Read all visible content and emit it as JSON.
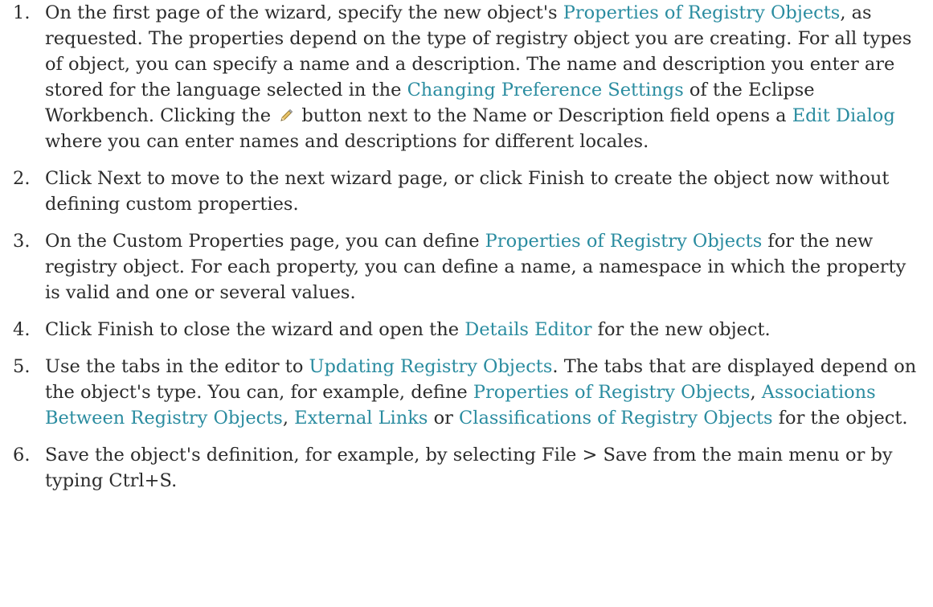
{
  "steps": [
    {
      "number": "1.",
      "segments": [
        {
          "text": "On the first page of the wizard, specify the new object's "
        },
        {
          "link": "Properties of Registry Objects"
        },
        {
          "text": ", as requested. The properties depend on the type of registry object you are creating. For all types of object, you can specify a name and a description. The name and description you enter are stored for the language selected in the "
        },
        {
          "link": "Changing Preference Settings"
        },
        {
          "text": " of the Eclipse Workbench. Clicking the "
        },
        {
          "icon": "pencil-icon"
        },
        {
          "text": " button next to the Name or Description field opens a "
        },
        {
          "link": "Edit Dialog"
        },
        {
          "text": " where you can enter names and descriptions for different locales."
        }
      ]
    },
    {
      "number": "2.",
      "segments": [
        {
          "text": "Click Next to move to the next wizard page, or click Finish to create the object now without defining custom properties."
        }
      ]
    },
    {
      "number": "3.",
      "segments": [
        {
          "text": "On the Custom Properties page, you can define "
        },
        {
          "link": "Properties of Registry Objects"
        },
        {
          "text": " for the new registry object. For each property, you can define a name, a namespace in which the property is valid and one or several values."
        }
      ]
    },
    {
      "number": "4.",
      "segments": [
        {
          "text": "Click Finish to close the wizard and open the "
        },
        {
          "link": "Details Editor"
        },
        {
          "text": " for the new object."
        }
      ]
    },
    {
      "number": "5.",
      "segments": [
        {
          "text": "Use the tabs in the editor to "
        },
        {
          "link": "Updating Registry Objects"
        },
        {
          "text": ". The tabs that are displayed depend on the object's type. You can, for example, define "
        },
        {
          "link": "Properties of Registry Objects"
        },
        {
          "text": ", "
        },
        {
          "link": "Associations Between Registry Objects"
        },
        {
          "text": ", "
        },
        {
          "link": "External Links"
        },
        {
          "text": " or "
        },
        {
          "link": "Classifications of Registry Objects"
        },
        {
          "text": " for the object."
        }
      ]
    },
    {
      "number": "6.",
      "segments": [
        {
          "text": "Save the object's definition, for example, by selecting File > Save from the main menu or by typing Ctrl+S."
        }
      ]
    }
  ],
  "colors": {
    "text": "#2b2b2b",
    "link": "#2a8ca0"
  }
}
